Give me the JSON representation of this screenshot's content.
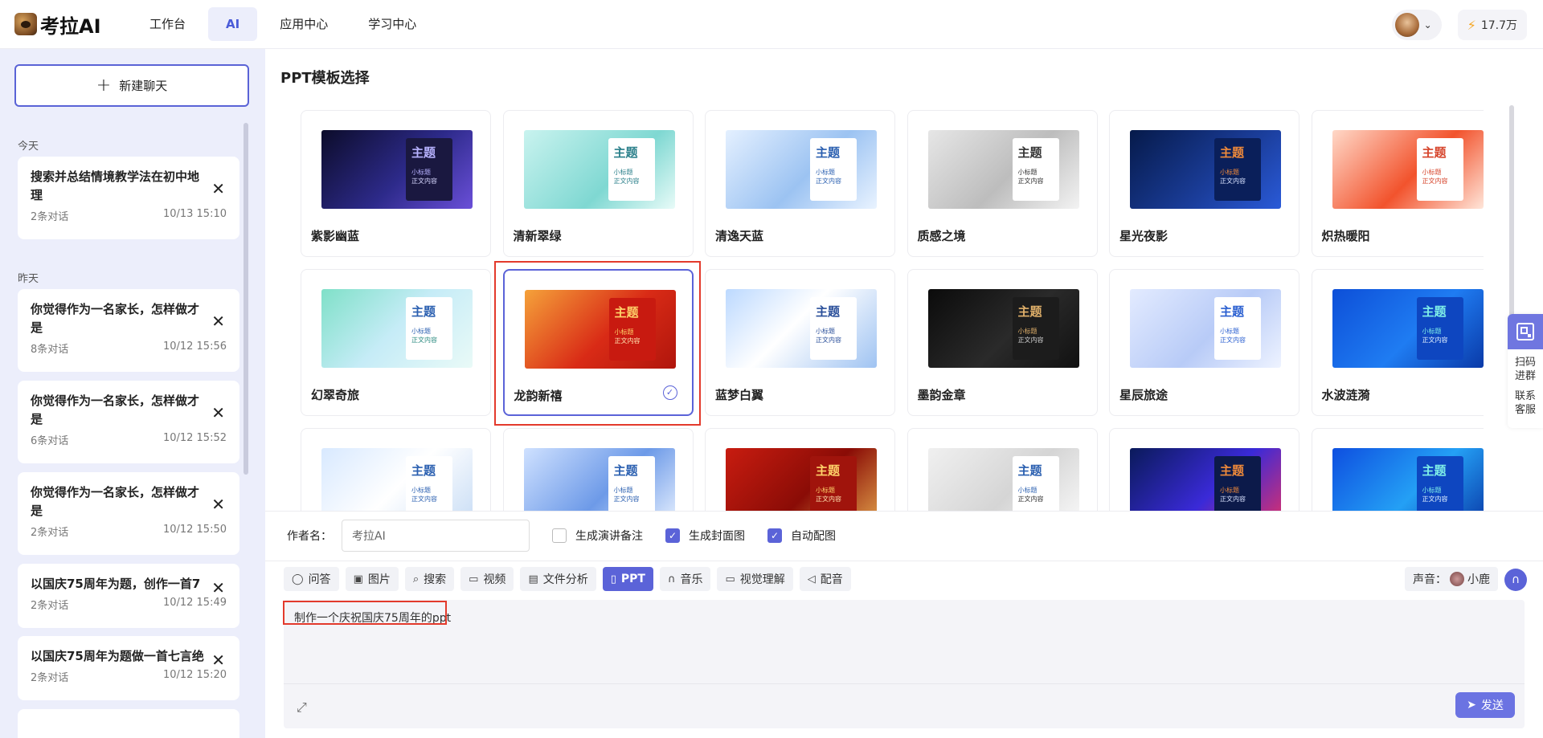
{
  "app": {
    "name": "考拉AI"
  },
  "nav": [
    {
      "label": "工作台",
      "active": false
    },
    {
      "label": "AI",
      "active": true
    },
    {
      "label": "应用中心",
      "active": false
    },
    {
      "label": "学习中心",
      "active": false
    }
  ],
  "header": {
    "credits": "17.7万"
  },
  "sidebar": {
    "new_chat_label": "新建聊天",
    "groups": [
      {
        "label": "今天",
        "chats": [
          {
            "title": "搜索并总结情境教学法在初中地理",
            "count": "2条对话",
            "time": "10/13 15:10"
          }
        ]
      },
      {
        "label": "昨天",
        "chats": [
          {
            "title": "你觉得作为一名家长，怎样做才是",
            "count": "8条对话",
            "time": "10/12 15:56"
          },
          {
            "title": "你觉得作为一名家长，怎样做才是",
            "count": "6条对话",
            "time": "10/12 15:52"
          },
          {
            "title": "你觉得作为一名家长，怎样做才是",
            "count": "2条对话",
            "time": "10/12 15:50"
          },
          {
            "title": "以国庆75周年为题，创作一首7",
            "count": "2条对话",
            "time": "10/12 15:49"
          },
          {
            "title": "以国庆75周年为题做一首七言绝",
            "count": "2条对话",
            "time": "10/12 15:20"
          }
        ]
      }
    ]
  },
  "main": {
    "title": "PPT模板选择",
    "template_thumb_text": {
      "heading": "主题",
      "subheading": "小标题",
      "body": "正文内容"
    },
    "templates": [
      {
        "name": "紫影幽蓝",
        "bg": "linear-gradient(135deg,#0c0c2a,#2d2a8a 55%,#6a4fd8)",
        "panel": "#1a1840",
        "accent": "#b7b2ff",
        "text": "#d8d8ff"
      },
      {
        "name": "清新翠绿",
        "bg": "linear-gradient(135deg,#c9f3ef,#7fd8d2 60%,#e8fbf8)",
        "panel": "#ffffff",
        "accent": "#2a7f8a",
        "text": "#2a7f8a"
      },
      {
        "name": "清逸天蓝",
        "bg": "linear-gradient(135deg,#e4f0ff,#9cc3f2 55%,#e9f3ff)",
        "panel": "#ffffff",
        "accent": "#2a5fb0",
        "text": "#2a5fb0"
      },
      {
        "name": "质感之境",
        "bg": "linear-gradient(135deg,#e6e6e6,#bdbdbd 55%,#f3f3f3)",
        "panel": "#ffffff",
        "accent": "#333333",
        "text": "#333333"
      },
      {
        "name": "星光夜影",
        "bg": "linear-gradient(135deg,#061a4a,#1b3e9c 60%,#2a5ad8)",
        "panel": "#0a1f5a",
        "accent": "#f08a3a",
        "text": "#d8e2ff"
      },
      {
        "name": "炽热暖阳",
        "bg": "linear-gradient(135deg,#ffd9c9,#f2532d 55%,#ffe6da)",
        "panel": "#ffffff",
        "accent": "#d6432a",
        "text": "#d6432a"
      },
      {
        "name": "幻翠奇旅",
        "bg": "linear-gradient(135deg,#7fe0c8,#c6ecf7 50%,#e9faf7)",
        "panel": "#ffffff",
        "accent": "#2a5fb0",
        "text": "#2a8a7f"
      },
      {
        "name": "龙韵新禧",
        "bg": "linear-gradient(135deg,#f5a23a,#d92b16 55%,#b0150c)",
        "panel": "#c81a10",
        "accent": "#ffd36a",
        "text": "#ffe3b0",
        "selected": true
      },
      {
        "name": "蓝梦白翼",
        "bg": "linear-gradient(135deg,#bcd9ff,#ffffff 45%,#9fc3f2)",
        "panel": "#ffffff",
        "accent": "#2a4f9a",
        "text": "#2a4f9a"
      },
      {
        "name": "墨韵金章",
        "bg": "linear-gradient(135deg,#0b0b0b,#2a2a2a 55%,#111)",
        "panel": "#1c1c1c",
        "accent": "#e0b06a",
        "text": "#cfcfcf"
      },
      {
        "name": "星辰旅途",
        "bg": "linear-gradient(135deg,#e3ebff,#b8cbf7 55%,#eef3ff)",
        "panel": "#ffffff",
        "accent": "#2a5fd0",
        "text": "#2a5fd0"
      },
      {
        "name": "水波涟漪",
        "bg": "linear-gradient(135deg,#0d4fd8,#1f7cf2 55%,#0a3aa8)",
        "panel": "#0e46c0",
        "accent": "#7ff0e8",
        "text": "#e0f0ff"
      },
      {
        "name": "",
        "bg": "linear-gradient(135deg,#d8e9ff,#ffffff 50%,#c7dcf5)",
        "panel": "#ffffff",
        "accent": "#2a5fb0",
        "text": "#2a5fb0"
      },
      {
        "name": "",
        "bg": "linear-gradient(135deg,#cfe1ff,#6d9ae8 55%,#e8f1ff)",
        "panel": "#ffffff",
        "accent": "#2a5fb0",
        "text": "#2a5fb0"
      },
      {
        "name": "",
        "bg": "linear-gradient(135deg,#c81c10,#8a0c06 55%,#e0a04a)",
        "panel": "#a0140c",
        "accent": "#ffd36a",
        "text": "#ffe3b0"
      },
      {
        "name": "",
        "bg": "linear-gradient(135deg,#f0f0f0,#d5d5d5 55%,#fafafa)",
        "panel": "#ffffff",
        "accent": "#2a5fb0",
        "text": "#333333"
      },
      {
        "name": "",
        "bg": "linear-gradient(135deg,#0a1a5a,#3a2ad8 55%,#e0306a)",
        "panel": "#0c1a4a",
        "accent": "#f08a3a",
        "text": "#d8e2ff"
      },
      {
        "name": "",
        "bg": "linear-gradient(135deg,#0e4fe0,#24a0f5 55%,#0a3aa8)",
        "panel": "#0e46c0",
        "accent": "#7ff0e8",
        "text": "#e0f0ff"
      }
    ]
  },
  "options": {
    "author_label": "作者名：",
    "author_value": "考拉AI",
    "checkboxes": [
      {
        "label": "生成演讲备注",
        "checked": false
      },
      {
        "label": "生成封面图",
        "checked": true
      },
      {
        "label": "自动配图",
        "checked": true
      }
    ]
  },
  "tools": [
    {
      "label": "问答",
      "icon": "chat-bubble-icon",
      "glyph": "◯",
      "active": false
    },
    {
      "label": "图片",
      "icon": "image-icon",
      "glyph": "▣",
      "active": false
    },
    {
      "label": "搜索",
      "icon": "search-icon",
      "glyph": "⌕",
      "active": false
    },
    {
      "label": "视频",
      "icon": "video-icon",
      "glyph": "▭",
      "active": false
    },
    {
      "label": "文件分析",
      "icon": "file-icon",
      "glyph": "▤",
      "active": false
    },
    {
      "label": "PPT",
      "icon": "ppt-file-icon",
      "glyph": "▯",
      "active": true
    },
    {
      "label": "音乐",
      "icon": "headphone-icon",
      "glyph": "∩",
      "active": false
    },
    {
      "label": "视觉理解",
      "icon": "camera-icon",
      "glyph": "▭",
      "active": false
    },
    {
      "label": "配音",
      "icon": "speaker-icon",
      "glyph": "◁",
      "active": false
    }
  ],
  "voice": {
    "label": "声音：",
    "name": "小鹿"
  },
  "floating": {
    "qr_label": "扫码进群",
    "support_label": "联系客服"
  },
  "input": {
    "text": "制作一个庆祝国庆75周年的ppt"
  },
  "send_label": "发送"
}
